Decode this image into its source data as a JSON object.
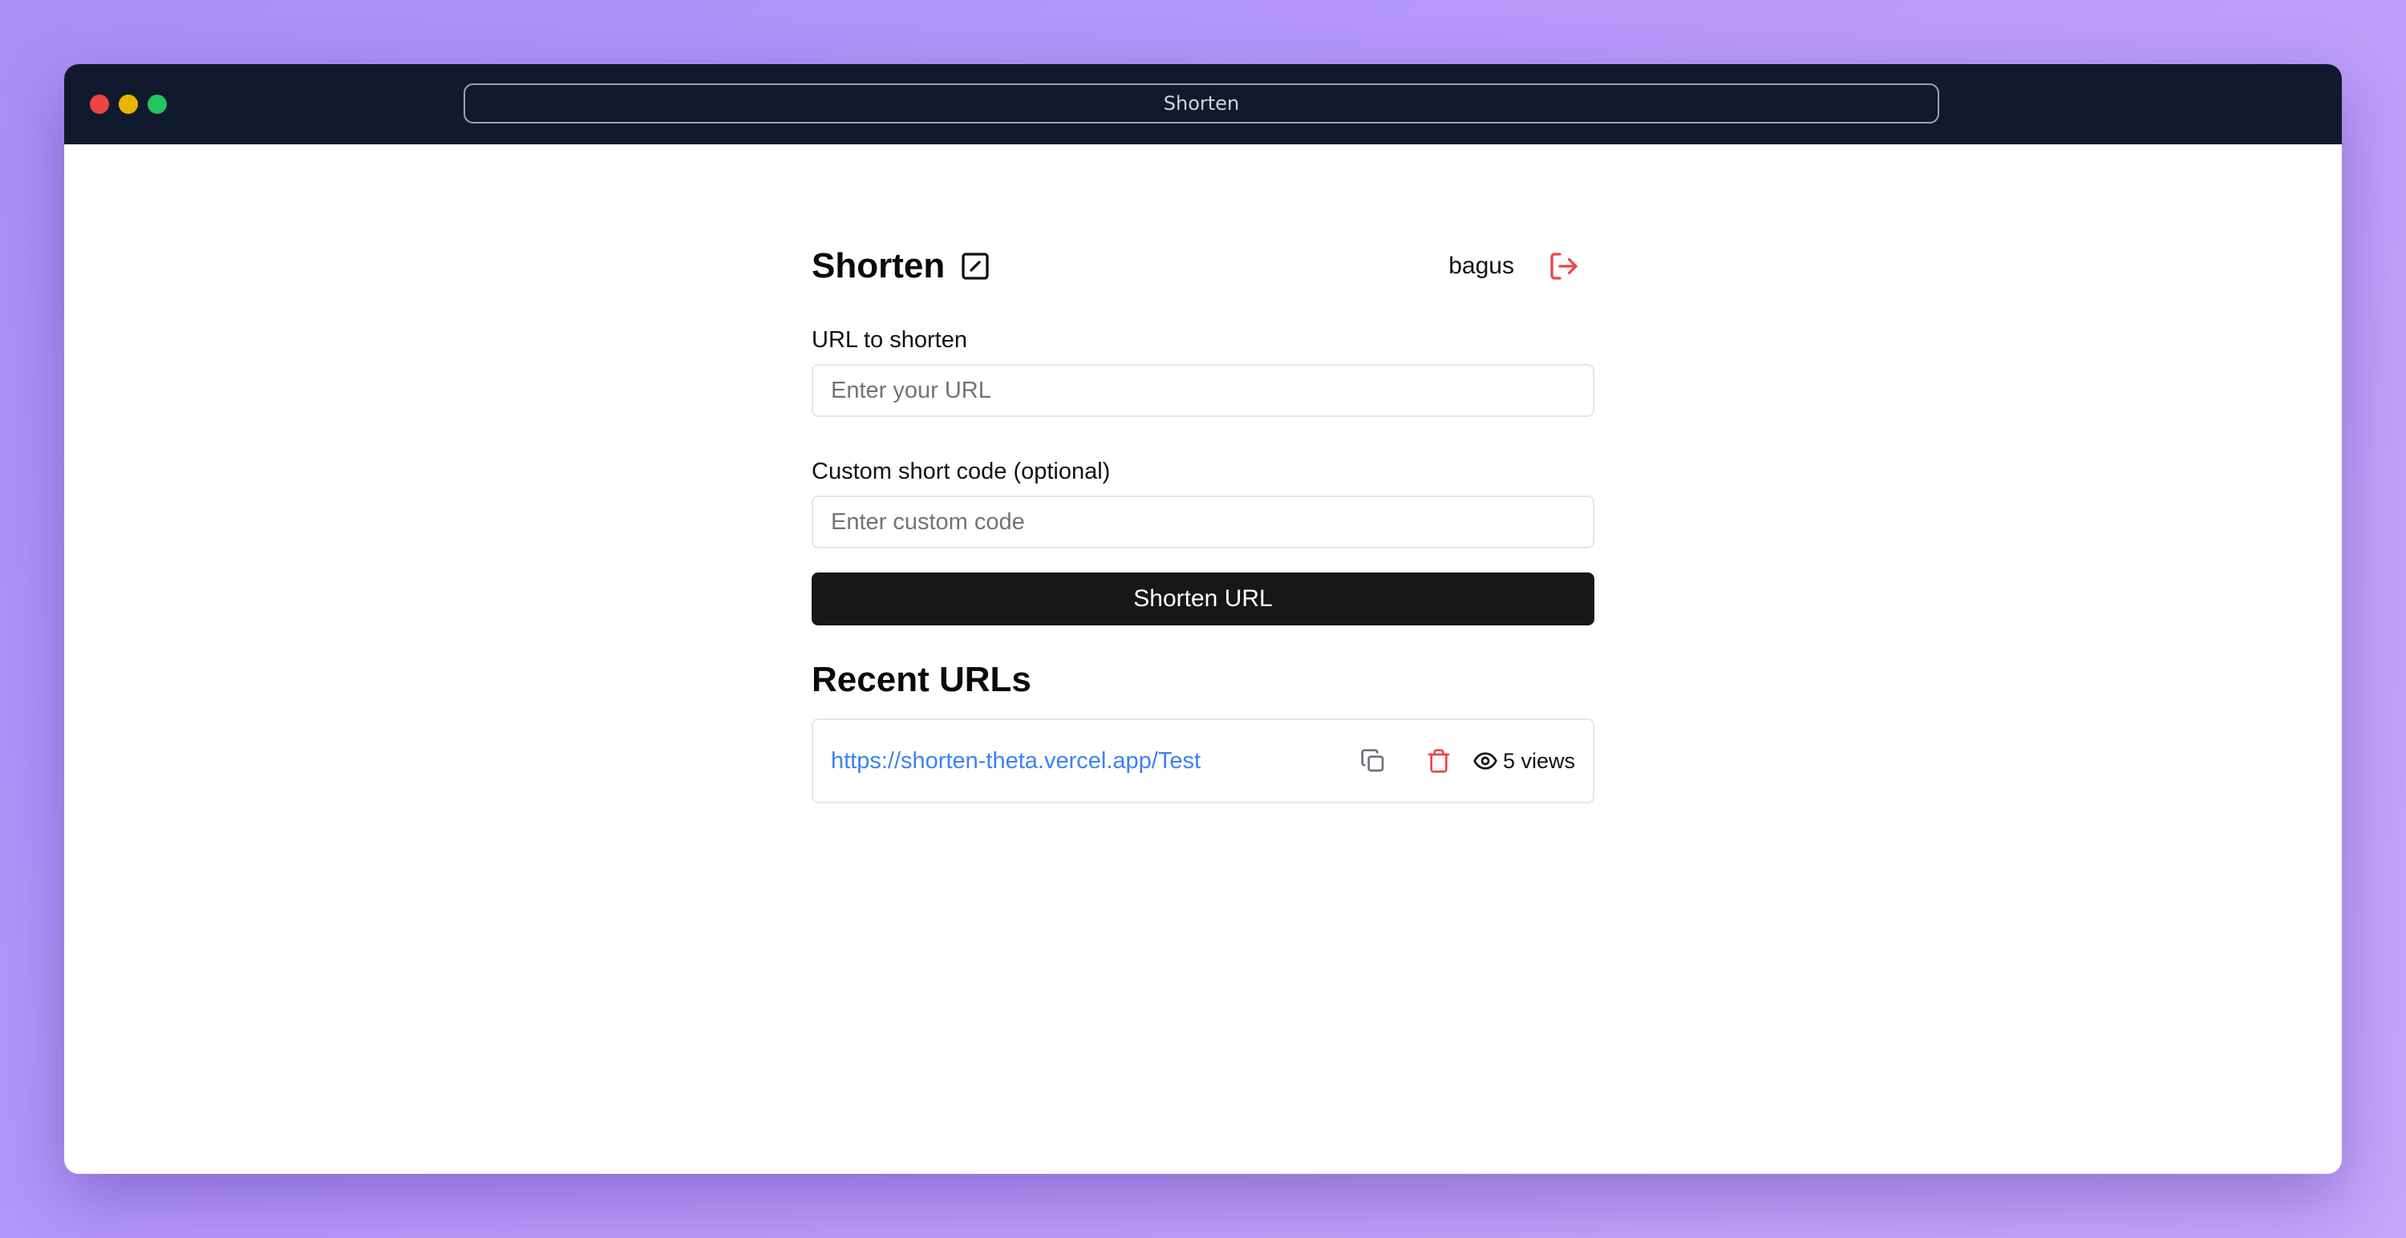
{
  "window": {
    "title": "Shorten"
  },
  "header": {
    "brand": "Shorten",
    "brand_icon": "square-pen-icon",
    "username": "bagus",
    "logout_icon": "log-out-icon"
  },
  "form": {
    "url_label": "URL to shorten",
    "url_placeholder": "Enter your URL",
    "url_value": "",
    "code_label": "Custom short code (optional)",
    "code_placeholder": "Enter custom code",
    "code_value": "",
    "submit_label": "Shorten URL"
  },
  "recent": {
    "title": "Recent URLs",
    "items": [
      {
        "url": "https://shorten-theta.vercel.app/Test",
        "views": "5 views",
        "copy_icon": "copy-icon",
        "delete_icon": "trash-icon",
        "views_icon": "eye-icon"
      }
    ]
  },
  "colors": {
    "accent_link": "#3b82f6",
    "danger": "#ef4444",
    "button_bg": "#171717",
    "titlebar_bg": "#111a2c"
  }
}
